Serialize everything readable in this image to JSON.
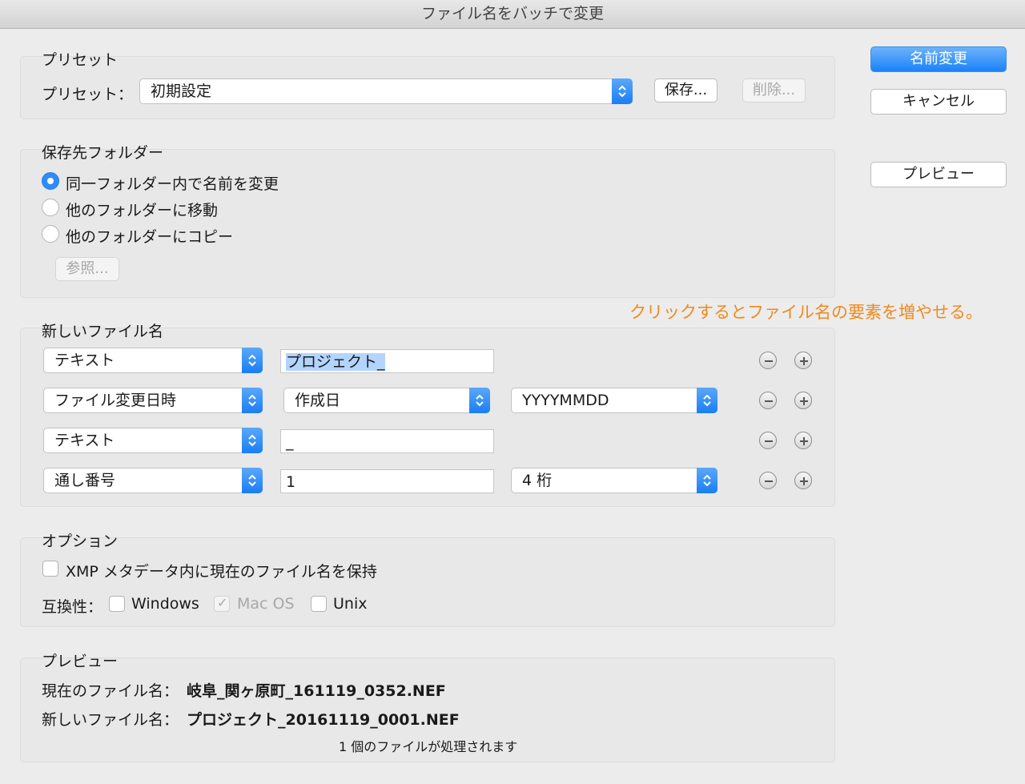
{
  "window": {
    "title": "ファイル名をバッチで変更"
  },
  "actions": {
    "rename": "名前変更",
    "cancel": "キャンセル",
    "preview": "プレビュー"
  },
  "preset": {
    "group_title": "プリセット",
    "label": "プリセット：",
    "selected": "初期設定",
    "save": "保存...",
    "delete": "削除..."
  },
  "destination": {
    "group_title": "保存先フォルダー",
    "options": [
      "同一フォルダー内で名前を変更",
      "他のフォルダーに移動",
      "他のフォルダーにコピー"
    ],
    "selected_index": 0,
    "browse": "参照..."
  },
  "new_name": {
    "group_title": "新しいファイル名",
    "annotation": "クリックするとファイル名の要素を増やせる。",
    "rows": [
      {
        "type": "テキスト",
        "text": "プロジェクト_"
      },
      {
        "type": "ファイル変更日時",
        "option": "作成日",
        "format": "YYYYMMDD"
      },
      {
        "type": "テキスト",
        "text": "_"
      },
      {
        "type": "通し番号",
        "text": "1",
        "format": "4 桁"
      }
    ]
  },
  "options": {
    "group_title": "オプション",
    "xmp": "XMP メタデータ内に現在のファイル名を保持",
    "compat_label": "互換性：",
    "windows": "Windows",
    "macos": "Mac OS",
    "unix": "Unix"
  },
  "preview": {
    "group_title": "プレビュー",
    "current_label": "現在のファイル名：",
    "current_value": "岐阜_関ヶ原町_161119_0352.NEF",
    "new_label": "新しいファイル名：",
    "new_value": "プロジェクト_20161119_0001.NEF",
    "count_text": "1 個のファイルが処理されます"
  },
  "colors": {
    "accent": "#1a82fb",
    "annotation": "#f08a1c"
  }
}
